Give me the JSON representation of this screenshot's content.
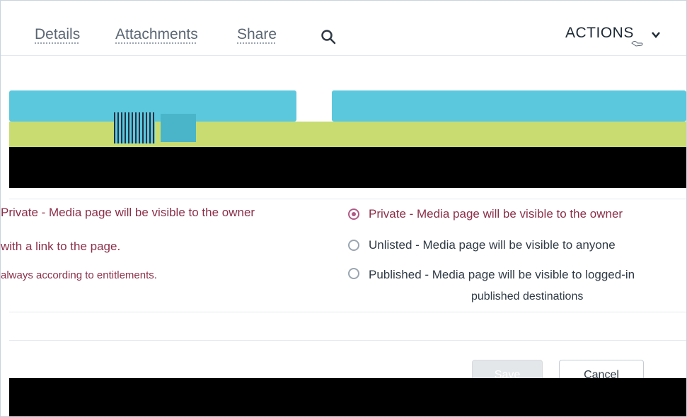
{
  "tabs": {
    "details": "Details",
    "attachments": "Attachments",
    "share": "Share"
  },
  "header": {
    "actions_label": "ACTIONS",
    "search_icon": "search-icon",
    "chevron_icon": "chevron-down-icon"
  },
  "publish": {
    "private_label": "Private - Media page will be visible to the owner",
    "private_cont": "with a link to the page.",
    "private_note": "always according to entitlements.",
    "options": [
      {
        "label": "Private - Media page will be visible to the owner",
        "selected": true
      },
      {
        "label": "Unlisted - Media page will be visible to anyone",
        "selected": false
      },
      {
        "label": "Published - Media page will be visible to logged-in",
        "selected": false
      }
    ],
    "published_cont": "published destinations"
  },
  "buttons": {
    "save_label": "Save",
    "cancel_label": "Cancel"
  },
  "colors": {
    "card": "#5bc8de",
    "band": "#c8dc72",
    "accent": "#8b2f4a",
    "radio_selected": "#b05a86"
  }
}
